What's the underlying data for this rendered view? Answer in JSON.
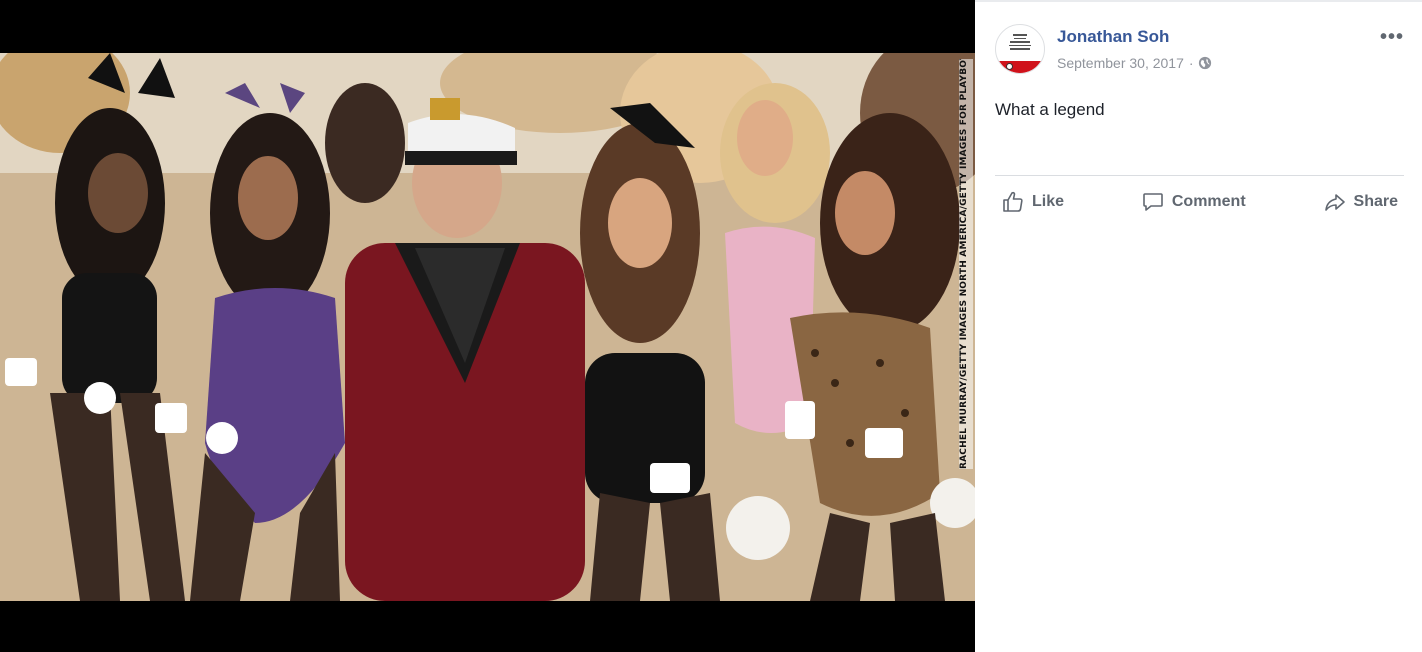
{
  "photo": {
    "credit": "RACHEL MURRAY/GETTY IMAGES NORTH AMERICA/GETTY IMAGES FOR PLAYBOY"
  },
  "post": {
    "author": "Jonathan Soh",
    "date": "September 30, 2017",
    "separator": "·",
    "privacy_icon": "globe-icon",
    "more_label": "•••",
    "caption": "What a legend"
  },
  "actions": {
    "like_label": "Like",
    "comment_label": "Comment",
    "share_label": "Share"
  },
  "colors": {
    "author_link": "#385898",
    "meta_text": "#90949c",
    "action_text": "#606770",
    "viewer_bg": "#000000"
  }
}
